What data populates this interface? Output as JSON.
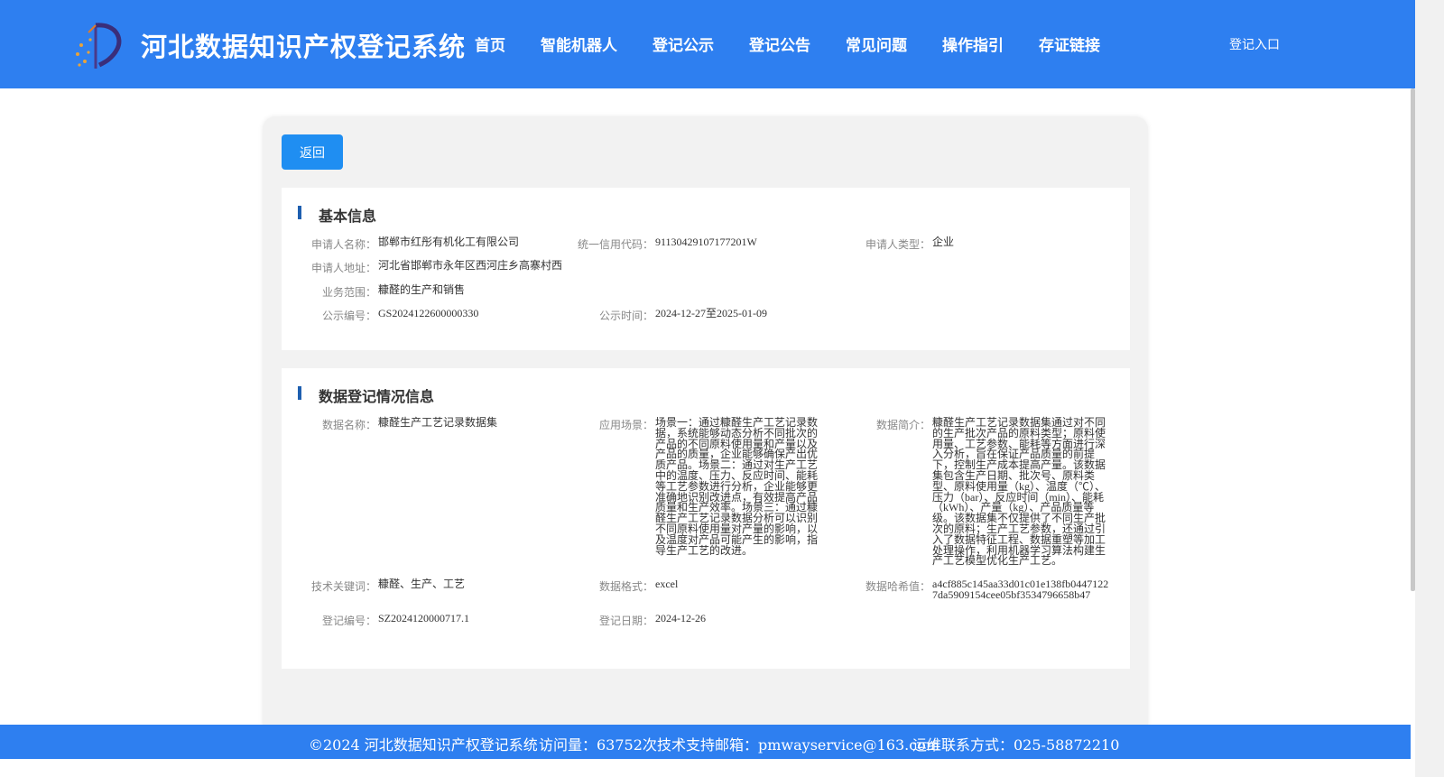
{
  "header": {
    "site_title": "河北数据知识产权登记系统",
    "nav": [
      "首页",
      "智能机器人",
      "登记公示",
      "登记公告",
      "常见问题",
      "操作指引",
      "存证链接"
    ],
    "login": "登记入口"
  },
  "back_label": "返回",
  "basic": {
    "title": "基本信息",
    "applicant_name_label": "申请人名称：",
    "applicant_name": "邯郸市红彤有机化工有限公司",
    "credit_code_label": "统一信用代码：",
    "credit_code": "91130429107177201W",
    "applicant_type_label": "申请人类型：",
    "applicant_type": "企业",
    "address_label": "申请人地址：",
    "address": "河北省邯郸市永年区西河庄乡高寨村西",
    "scope_label": "业务范围：",
    "scope": "糠醛的生产和销售",
    "notice_no_label": "公示编号：",
    "notice_no": "GS2024122600000330",
    "notice_time_label": "公示时间：",
    "notice_time": "2024-12-27至2025-01-09"
  },
  "registration": {
    "title": "数据登记情况信息",
    "data_name_label": "数据名称：",
    "data_name": "糠醛生产工艺记录数据集",
    "scenario_label": "应用场景：",
    "scenario": "场景一：通过糠醛生产工艺记录数据，系统能够动态分析不同批次的产品的不同原料使用量和产量以及产品的质量，企业能够确保产出优质产品。场景二：通过对生产工艺中的温度、压力、反应时间、能耗等工艺参数进行分析，企业能够更准确地识别改进点，有效提高产品质量和生产效率。场景三：通过糠醛生产工艺记录数据分析可以识别不同原料使用量对产量的影响，以及温度对产品可能产生的影响，指导生产工艺的改进。",
    "intro_label": "数据简介：",
    "intro": "糠醛生产工艺记录数据集通过对不同的生产批次产品的原料类型；原料使用量、工艺参数、能耗等方面进行深入分析，旨在保证产品质量的前提下，控制生产成本提高产量。该数据集包含生产日期、批次号、原料类型、原料使用量（kg）、温度（℃）、压力（bar）、反应时间（min）、能耗（kWh）、产量（kg）、产品质量等级。该数据集不仅提供了不同生产批次的原料；生产工艺参数，还通过引入了数据特征工程、数据重塑等加工处理操作，利用机器学习算法构建生产工艺模型优化生产工艺。",
    "keywords_label": "技术关键词：",
    "keywords": "糠醛、生产、工艺",
    "format_label": "数据格式：",
    "format": "excel",
    "hash_label": "数据哈希值：",
    "hash": "a4cf885c145aa33d01c01e138fb04471227da5909154cee05bf3534796658b47",
    "reg_no_label": "登记编号：",
    "reg_no": "SZ2024120000717.1",
    "reg_date_label": "登记日期：",
    "reg_date": "2024-12-26"
  },
  "footer": {
    "copyright": "©2024 河北数据知识产权登记系统",
    "visits": "访问量：63752次",
    "support": "技术支持邮箱：pmwayservice@163.com",
    "ops": "运维联系方式：025-58872210"
  },
  "colors": {
    "primary": "#2e7ff0",
    "button": "#1f8ef2",
    "accent_bar": "#1e5fb0"
  }
}
